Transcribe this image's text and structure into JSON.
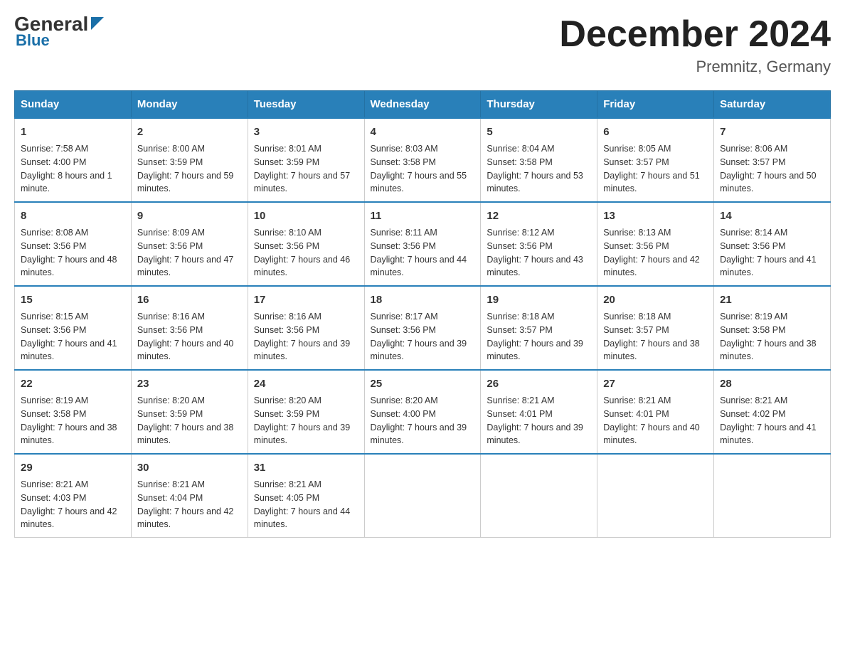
{
  "header": {
    "logo_general": "General",
    "logo_blue": "Blue",
    "month_title": "December 2024",
    "location": "Premnitz, Germany"
  },
  "days_of_week": [
    "Sunday",
    "Monday",
    "Tuesday",
    "Wednesday",
    "Thursday",
    "Friday",
    "Saturday"
  ],
  "weeks": [
    [
      {
        "day": "1",
        "sunrise": "7:58 AM",
        "sunset": "4:00 PM",
        "daylight": "8 hours and 1 minute."
      },
      {
        "day": "2",
        "sunrise": "8:00 AM",
        "sunset": "3:59 PM",
        "daylight": "7 hours and 59 minutes."
      },
      {
        "day": "3",
        "sunrise": "8:01 AM",
        "sunset": "3:59 PM",
        "daylight": "7 hours and 57 minutes."
      },
      {
        "day": "4",
        "sunrise": "8:03 AM",
        "sunset": "3:58 PM",
        "daylight": "7 hours and 55 minutes."
      },
      {
        "day": "5",
        "sunrise": "8:04 AM",
        "sunset": "3:58 PM",
        "daylight": "7 hours and 53 minutes."
      },
      {
        "day": "6",
        "sunrise": "8:05 AM",
        "sunset": "3:57 PM",
        "daylight": "7 hours and 51 minutes."
      },
      {
        "day": "7",
        "sunrise": "8:06 AM",
        "sunset": "3:57 PM",
        "daylight": "7 hours and 50 minutes."
      }
    ],
    [
      {
        "day": "8",
        "sunrise": "8:08 AM",
        "sunset": "3:56 PM",
        "daylight": "7 hours and 48 minutes."
      },
      {
        "day": "9",
        "sunrise": "8:09 AM",
        "sunset": "3:56 PM",
        "daylight": "7 hours and 47 minutes."
      },
      {
        "day": "10",
        "sunrise": "8:10 AM",
        "sunset": "3:56 PM",
        "daylight": "7 hours and 46 minutes."
      },
      {
        "day": "11",
        "sunrise": "8:11 AM",
        "sunset": "3:56 PM",
        "daylight": "7 hours and 44 minutes."
      },
      {
        "day": "12",
        "sunrise": "8:12 AM",
        "sunset": "3:56 PM",
        "daylight": "7 hours and 43 minutes."
      },
      {
        "day": "13",
        "sunrise": "8:13 AM",
        "sunset": "3:56 PM",
        "daylight": "7 hours and 42 minutes."
      },
      {
        "day": "14",
        "sunrise": "8:14 AM",
        "sunset": "3:56 PM",
        "daylight": "7 hours and 41 minutes."
      }
    ],
    [
      {
        "day": "15",
        "sunrise": "8:15 AM",
        "sunset": "3:56 PM",
        "daylight": "7 hours and 41 minutes."
      },
      {
        "day": "16",
        "sunrise": "8:16 AM",
        "sunset": "3:56 PM",
        "daylight": "7 hours and 40 minutes."
      },
      {
        "day": "17",
        "sunrise": "8:16 AM",
        "sunset": "3:56 PM",
        "daylight": "7 hours and 39 minutes."
      },
      {
        "day": "18",
        "sunrise": "8:17 AM",
        "sunset": "3:56 PM",
        "daylight": "7 hours and 39 minutes."
      },
      {
        "day": "19",
        "sunrise": "8:18 AM",
        "sunset": "3:57 PM",
        "daylight": "7 hours and 39 minutes."
      },
      {
        "day": "20",
        "sunrise": "8:18 AM",
        "sunset": "3:57 PM",
        "daylight": "7 hours and 38 minutes."
      },
      {
        "day": "21",
        "sunrise": "8:19 AM",
        "sunset": "3:58 PM",
        "daylight": "7 hours and 38 minutes."
      }
    ],
    [
      {
        "day": "22",
        "sunrise": "8:19 AM",
        "sunset": "3:58 PM",
        "daylight": "7 hours and 38 minutes."
      },
      {
        "day": "23",
        "sunrise": "8:20 AM",
        "sunset": "3:59 PM",
        "daylight": "7 hours and 38 minutes."
      },
      {
        "day": "24",
        "sunrise": "8:20 AM",
        "sunset": "3:59 PM",
        "daylight": "7 hours and 39 minutes."
      },
      {
        "day": "25",
        "sunrise": "8:20 AM",
        "sunset": "4:00 PM",
        "daylight": "7 hours and 39 minutes."
      },
      {
        "day": "26",
        "sunrise": "8:21 AM",
        "sunset": "4:01 PM",
        "daylight": "7 hours and 39 minutes."
      },
      {
        "day": "27",
        "sunrise": "8:21 AM",
        "sunset": "4:01 PM",
        "daylight": "7 hours and 40 minutes."
      },
      {
        "day": "28",
        "sunrise": "8:21 AM",
        "sunset": "4:02 PM",
        "daylight": "7 hours and 41 minutes."
      }
    ],
    [
      {
        "day": "29",
        "sunrise": "8:21 AM",
        "sunset": "4:03 PM",
        "daylight": "7 hours and 42 minutes."
      },
      {
        "day": "30",
        "sunrise": "8:21 AM",
        "sunset": "4:04 PM",
        "daylight": "7 hours and 42 minutes."
      },
      {
        "day": "31",
        "sunrise": "8:21 AM",
        "sunset": "4:05 PM",
        "daylight": "7 hours and 44 minutes."
      },
      null,
      null,
      null,
      null
    ]
  ]
}
